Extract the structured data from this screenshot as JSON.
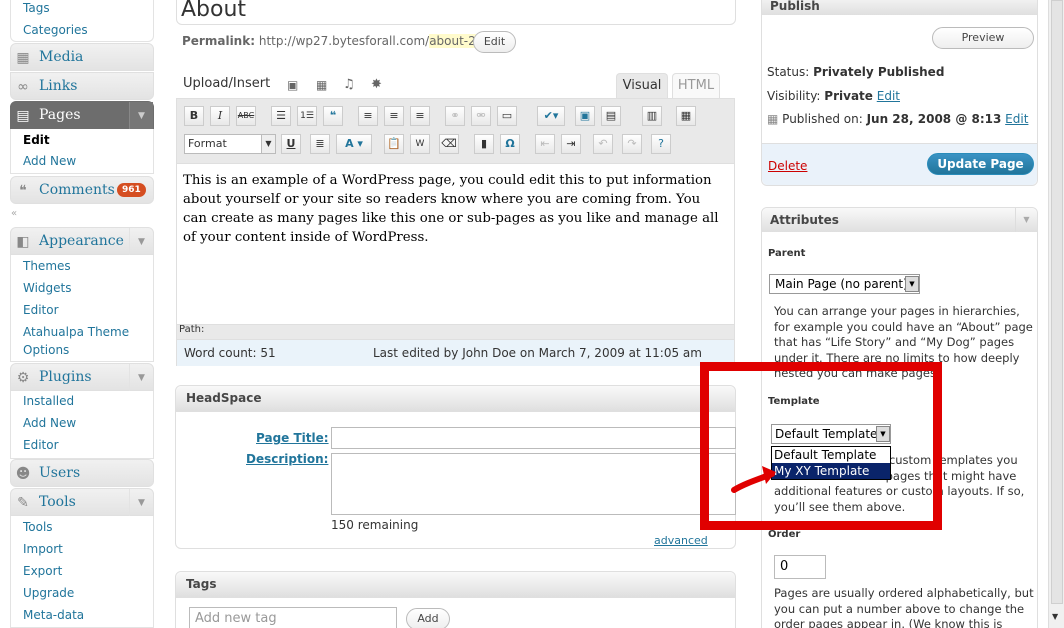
{
  "sidebar": {
    "top_items": [
      "Tags",
      "Categories"
    ],
    "menus": {
      "media": "Media",
      "links": "Links",
      "pages": "Pages",
      "comments": "Comments",
      "comments_count": "961",
      "appearance": "Appearance",
      "plugins": "Plugins",
      "users": "Users",
      "tools": "Tools"
    },
    "pages_sub": [
      "Edit",
      "Add New"
    ],
    "appearance_sub": [
      "Themes",
      "Widgets",
      "Editor",
      "Atahualpa Theme",
      "Options"
    ],
    "plugins_sub": [
      "Installed",
      "Add New",
      "Editor"
    ],
    "tools_sub": [
      "Tools",
      "Import",
      "Export",
      "Upgrade",
      "Meta-data"
    ],
    "collapse_icon": "«"
  },
  "editor": {
    "title_value": "About",
    "permalink_label": "Permalink:",
    "permalink_base": "http://wp27.bytesforall.com/",
    "permalink_slug": "about-2",
    "permalink_end": "/",
    "edit_button": "Edit",
    "upload_insert": "Upload/Insert",
    "tab_visual": "Visual",
    "tab_html": "HTML",
    "format_select": "Format",
    "content": "This is an example of a WordPress page, you could edit this to put information about yourself or your site so readers know where you are coming from. You can create as many pages like this one or sub-pages as you like and manage all of your content inside of WordPress.",
    "path_label": "Path:",
    "word_count": "Word count: 51",
    "last_edited": "Last edited by John Doe on March 7, 2009 at 11:05 am"
  },
  "headspace": {
    "title": "HeadSpace",
    "page_title_label": "Page Title:",
    "description_label": "Description:",
    "remaining": "150 remaining",
    "advanced": "advanced"
  },
  "tags": {
    "title": "Tags",
    "placeholder": "Add new tag",
    "add_button": "Add"
  },
  "publish": {
    "title": "Publish",
    "preview_button": "Preview",
    "status_label": "Status:",
    "status_value": "Privately Published",
    "visibility_label": "Visibility:",
    "visibility_value": "Private",
    "visibility_edit": "Edit",
    "published_label": "Published on:",
    "published_value": "Jun 28, 2008 @ 8:13",
    "published_edit": "Edit",
    "delete": "Delete",
    "update_button": "Update Page"
  },
  "attributes": {
    "title": "Attributes",
    "parent_label": "Parent",
    "parent_value": "Main Page (no parent)",
    "parent_help": "You can arrange your pages in hierarchies, for example you could have an “About” page that has “Life Story” and “My Dog” pages under it. There are no limits to how deeply nested you can make pages.",
    "template_label": "Template",
    "template_value": "Default Template",
    "template_options": [
      "Default Template",
      "My XY Template"
    ],
    "template_help": "Some themes have custom templates you can use for certain pages that might have additional features or custom layouts. If so, you’ll see them above.",
    "order_label": "Order",
    "order_value": "0",
    "order_help": "Pages are usually ordered alphabetically, but you can put a number above to change the order pages appear in. (We know this is"
  },
  "colors": {
    "link": "#21759b",
    "annotation_red": "#e00000",
    "primary_button": "#2583ad",
    "badge": "#d54e21"
  }
}
